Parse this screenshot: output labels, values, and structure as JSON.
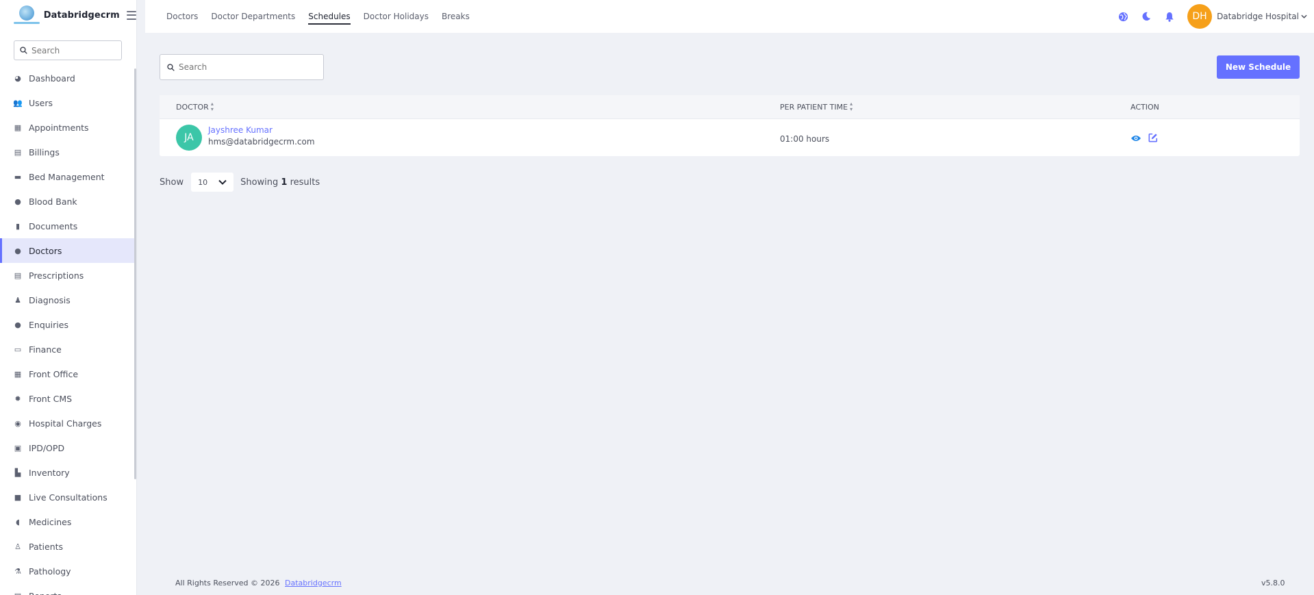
{
  "brand": {
    "name": "Databridgecrm"
  },
  "sidebar": {
    "search_placeholder": "Search",
    "items": [
      {
        "label": "Dashboard",
        "icon": "chart-pie-icon"
      },
      {
        "label": "Users",
        "icon": "users-icon"
      },
      {
        "label": "Appointments",
        "icon": "calendar-check-icon"
      },
      {
        "label": "Billings",
        "icon": "file-invoice-icon"
      },
      {
        "label": "Bed Management",
        "icon": "bed-icon"
      },
      {
        "label": "Blood Bank",
        "icon": "droplet-icon"
      },
      {
        "label": "Documents",
        "icon": "file-icon"
      },
      {
        "label": "Doctors",
        "icon": "user-doctor-icon"
      },
      {
        "label": "Prescriptions",
        "icon": "prescription-icon"
      },
      {
        "label": "Diagnosis",
        "icon": "diagnoses-icon"
      },
      {
        "label": "Enquiries",
        "icon": "question-circle-icon"
      },
      {
        "label": "Finance",
        "icon": "money-bill-icon"
      },
      {
        "label": "Front Office",
        "icon": "hospital-icon"
      },
      {
        "label": "Front CMS",
        "icon": "gear-icon"
      },
      {
        "label": "Hospital Charges",
        "icon": "coins-icon"
      },
      {
        "label": "IPD/OPD",
        "icon": "copy-icon"
      },
      {
        "label": "Inventory",
        "icon": "dolly-icon"
      },
      {
        "label": "Live Consultations",
        "icon": "video-icon"
      },
      {
        "label": "Medicines",
        "icon": "capsules-icon"
      },
      {
        "label": "Patients",
        "icon": "user-injured-icon"
      },
      {
        "label": "Pathology",
        "icon": "flask-icon"
      },
      {
        "label": "Reports",
        "icon": "file-lines-icon"
      }
    ],
    "active_index": 7
  },
  "topbar": {
    "tabs": [
      "Doctors",
      "Doctor Departments",
      "Schedules",
      "Doctor Holidays",
      "Breaks"
    ],
    "active_tab": "Schedules",
    "user": {
      "initials": "DH",
      "name": "Databridge Hospital"
    }
  },
  "main": {
    "search_placeholder": "Search",
    "new_button": "New Schedule",
    "columns": {
      "doctor": "DOCTOR",
      "time": "PER PATIENT TIME",
      "action": "ACTION"
    },
    "rows": [
      {
        "initials": "JA",
        "name": "Jayshree Kumar",
        "email": "hms@databridgecrm.com",
        "per_patient_time": "01:00 hours"
      }
    ],
    "pager": {
      "show_label": "Show",
      "page_size": "10",
      "showing_prefix": "Showing",
      "count": "1",
      "showing_suffix": "results"
    }
  },
  "footer": {
    "text": "All Rights Reserved © 2026",
    "link": "Databridgecrm",
    "version": "v5.8.0"
  },
  "colors": {
    "accent": "#6571ff",
    "avatar_user": "#f6a01a",
    "avatar_row": "#3cc6a8"
  }
}
